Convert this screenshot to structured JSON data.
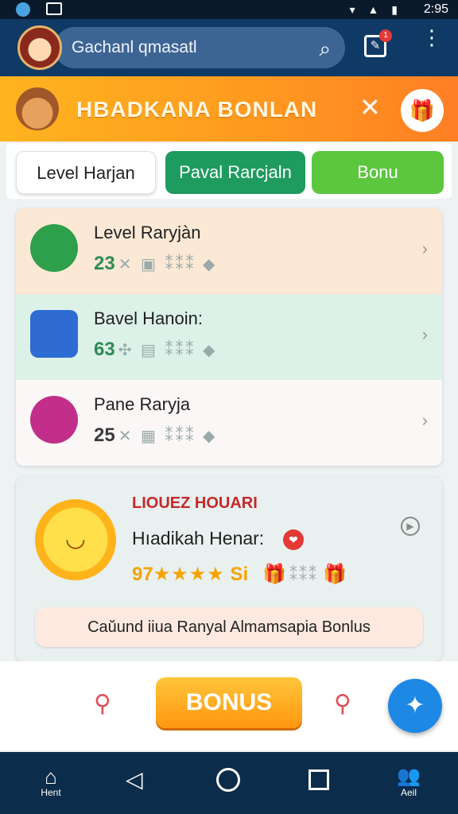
{
  "status_bar": {
    "time": "2:95",
    "icons": "▾ ▲ ▮"
  },
  "app_bar": {
    "search_text": "Gachanl qmasatl",
    "search_icon": "⌕",
    "edit_icon": "✎",
    "badge": "1",
    "more_icon": "⋮"
  },
  "banner": {
    "title": "HBADKANA BONLAN",
    "close": "✕",
    "gift": "🎁"
  },
  "tabs": [
    {
      "label": "Level Harjan"
    },
    {
      "label": "Paval Rarcjaln"
    },
    {
      "label": "Bonu"
    }
  ],
  "list": [
    {
      "title": "Level Raryjàn",
      "count": "23",
      "extra": "✕ ▣ ⁑⁑⁑ ◆"
    },
    {
      "title": "Bavel Hanoin:",
      "count": "63",
      "extra": "✣ ▤ ⁑⁑⁑ ◆"
    },
    {
      "title": "Pane Raryja",
      "count": "25",
      "extra": "✕ ▦ ⁑⁑⁑ ◆"
    }
  ],
  "row_arrow": "›",
  "promo": {
    "head": "LIOUEZ HOUARI",
    "title": "Hıadikah Henar:",
    "rating": "97",
    "stars": "★★★★",
    "suffix": "Si",
    "gift": "🎁",
    "grid": "⁑⁑⁑",
    "box": "🎁",
    "button": "Caŭund iiua Ranyal Almamsapia Bonlus",
    "heart": "❤",
    "info": "▶",
    "sun_face": "◡"
  },
  "action_bar": {
    "bonus_label": "BONUS",
    "pin_left": "⚲",
    "pin_right": "⚲",
    "fab_icon": "✦"
  },
  "navbar": {
    "home_label": "Hent",
    "account_label": "Aeil",
    "home_icon": "⌂",
    "back_icon": "◁",
    "account_icon": "👥"
  },
  "colors": {
    "primary": "#0f3a66",
    "accent": "#ff9a1f",
    "green": "#1e9b5e",
    "fab": "#1e88e5"
  }
}
